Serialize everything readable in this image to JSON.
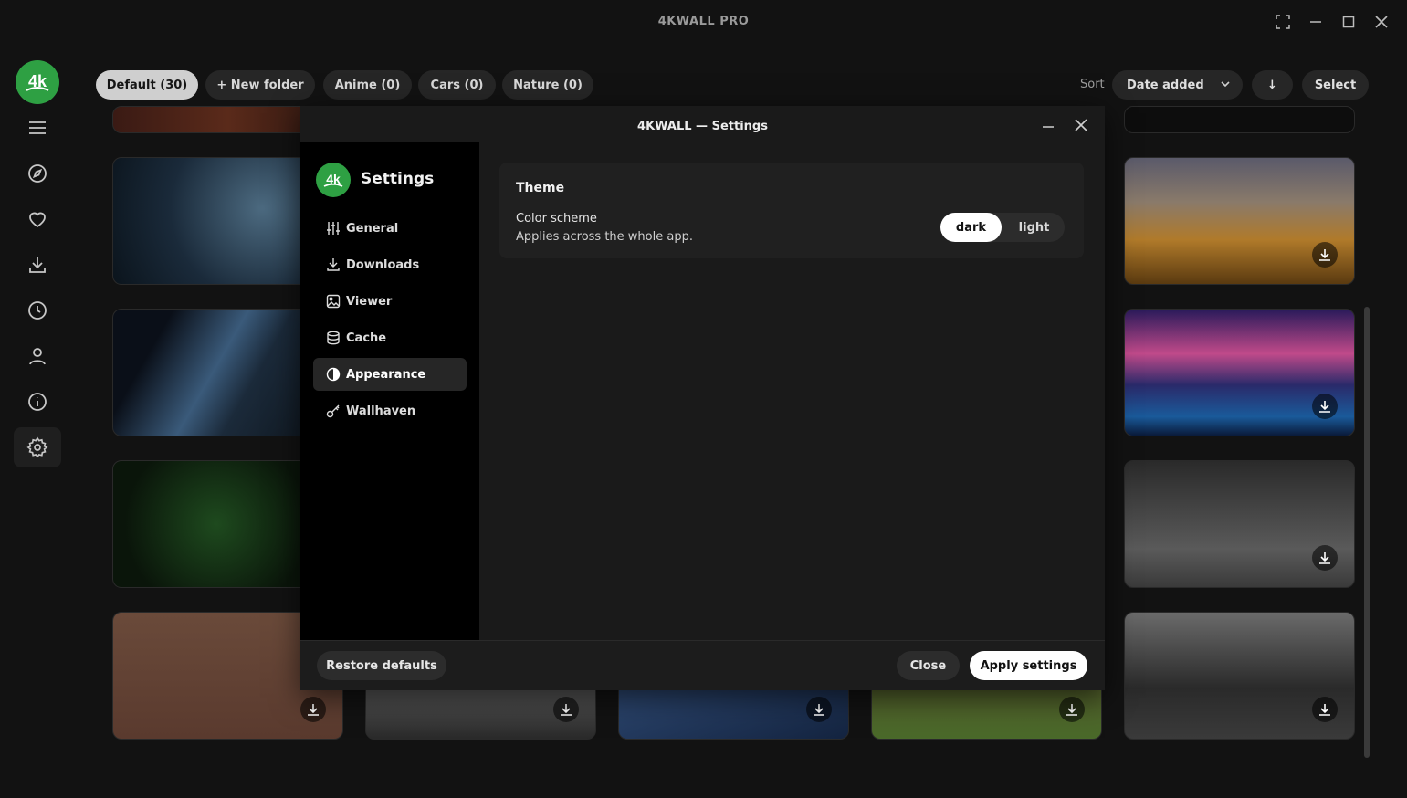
{
  "app": {
    "title": "4KWALL PRO"
  },
  "window_controls": [
    "fullscreen-icon",
    "minimize-icon",
    "maximize-icon",
    "close-icon"
  ],
  "sidebar": {
    "logo_text": "4k",
    "items": [
      "menu-icon",
      "explore-icon",
      "heart-icon",
      "download-icon",
      "history-icon",
      "user-icon",
      "info-icon",
      "gear-icon"
    ],
    "active": "gear-icon"
  },
  "folders": [
    {
      "label": "Default (30)",
      "active": true
    },
    {
      "label": "+ New folder",
      "active": false
    },
    {
      "label": "Anime (0)",
      "active": false
    },
    {
      "label": "Cars (0)",
      "active": false
    },
    {
      "label": "Nature (0)",
      "active": false
    }
  ],
  "sort": {
    "label": "Sort",
    "value": "Date added",
    "direction_icon": "↓",
    "select_label": "Select"
  },
  "dialog": {
    "title": "4KWALL — Settings",
    "nav_title": "Settings",
    "nav_logo_text": "4k",
    "nav": [
      {
        "label": "General",
        "icon": "sliders-icon"
      },
      {
        "label": "Downloads",
        "icon": "download-icon"
      },
      {
        "label": "Viewer",
        "icon": "image-icon"
      },
      {
        "label": "Cache",
        "icon": "database-icon"
      },
      {
        "label": "Appearance",
        "icon": "contrast-icon",
        "active": true
      },
      {
        "label": "Wallhaven",
        "icon": "key-icon"
      }
    ],
    "theme": {
      "title": "Theme",
      "label": "Color scheme",
      "description": "Applies across the whole app.",
      "options": [
        "dark",
        "light"
      ],
      "selected": "dark"
    },
    "footer": {
      "restore": "Restore defaults",
      "close": "Close",
      "apply": "Apply settings"
    }
  },
  "colors": {
    "accent_green": "#2ea043",
    "background": "#121212",
    "dialog": "#1a1a1a"
  }
}
